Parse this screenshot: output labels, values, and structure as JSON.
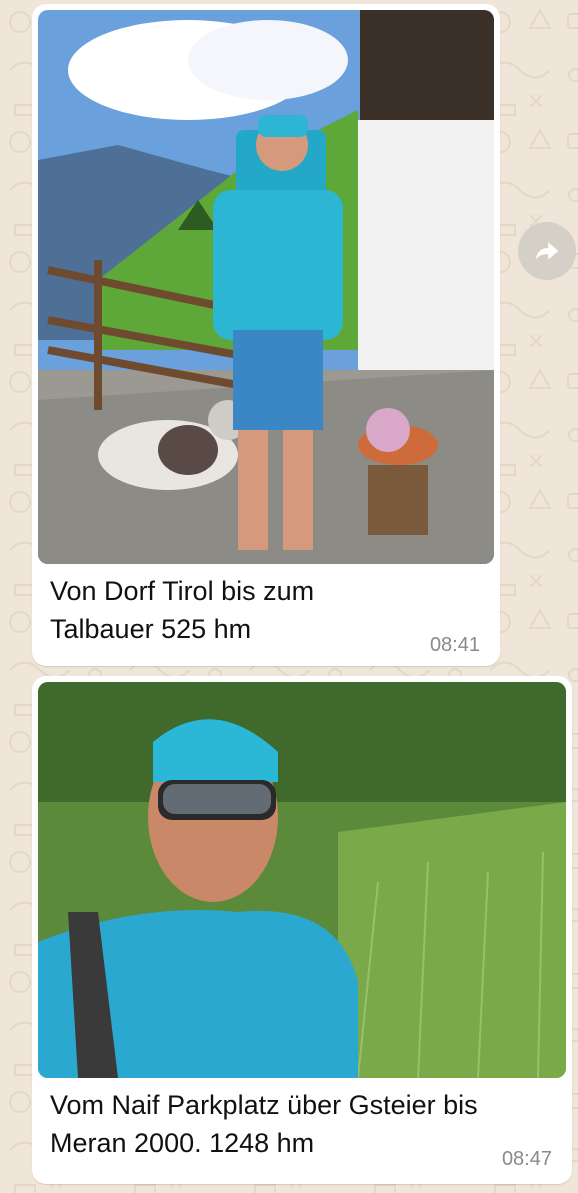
{
  "messages": [
    {
      "caption": "Von Dorf Tirol bis zum Talbauer 525 hm",
      "time": "08:41",
      "media": "photo"
    },
    {
      "caption": "Vom Naif Parkplatz über Gsteier bis Meran 2000. 1248 hm",
      "time": "08:47",
      "media": "photo"
    }
  ],
  "icons": {
    "forward": "forward-arrow-icon"
  },
  "colors": {
    "wallpaper": "#efe6d9",
    "bubble": "#ffffff",
    "timestamp": "#8a8a8a",
    "forward_button": "#d5d0c7"
  }
}
